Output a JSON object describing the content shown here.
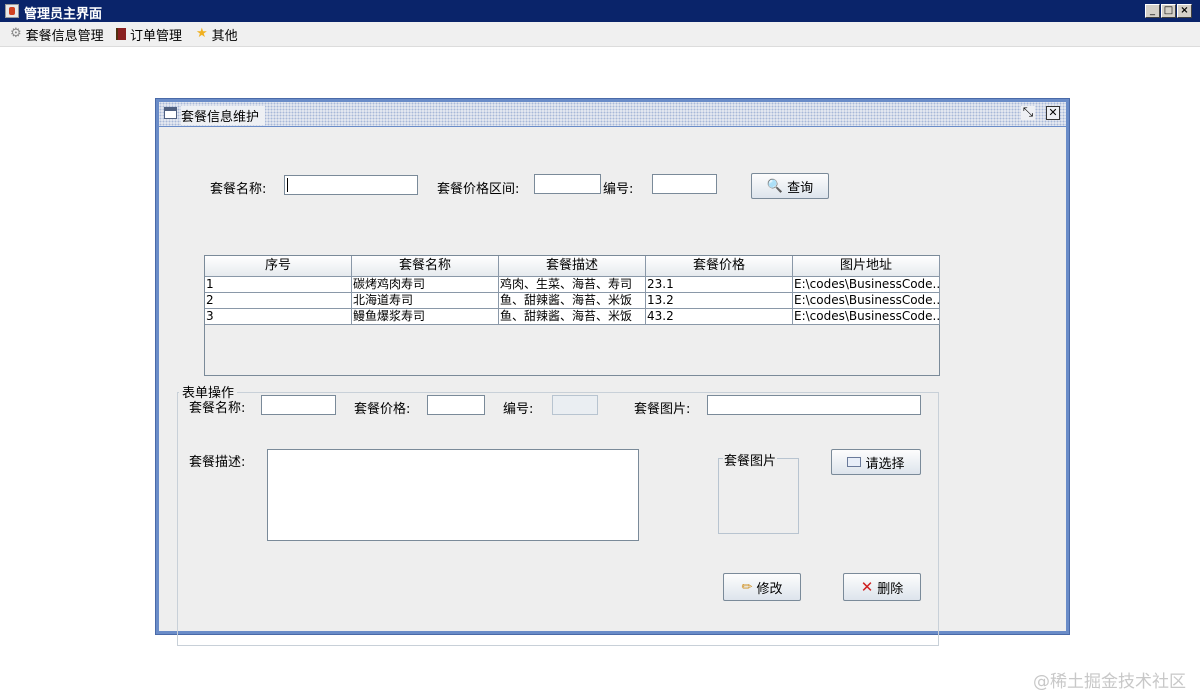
{
  "window": {
    "title": "管理员主界面"
  },
  "menu": [
    {
      "label": "套餐信息管理",
      "icon": "gear-icon"
    },
    {
      "label": "订单管理",
      "icon": "books-icon"
    },
    {
      "label": "其他",
      "icon": "star-icon"
    }
  ],
  "internal_frame": {
    "title": "套餐信息维护"
  },
  "search": {
    "name_label": "套餐名称:",
    "price_range_label": "套餐价格区间:",
    "id_label": "编号:",
    "query_button": "查询",
    "name_value": "",
    "price_min": "",
    "id_value": ""
  },
  "table": {
    "columns": [
      "序号",
      "套餐名称",
      "套餐描述",
      "套餐价格",
      "图片地址"
    ],
    "rows": [
      [
        "1",
        "碳烤鸡肉寿司",
        "鸡肉、生菜、海苔、寿司",
        "23.1",
        "E:\\codes\\BusinessCode..."
      ],
      [
        "2",
        "北海道寿司",
        "鱼、甜辣酱、海苔、米饭",
        "13.2",
        "E:\\codes\\BusinessCode..."
      ],
      [
        "3",
        "鳗鱼爆浆寿司",
        "鱼、甜辣酱、海苔、米饭",
        "43.2",
        "E:\\codes\\BusinessCode..."
      ]
    ]
  },
  "form": {
    "legend": "表单操作",
    "name_label": "套餐名称:",
    "price_label": "套餐价格:",
    "id_label": "编号:",
    "image_label": "套餐图片:",
    "desc_label": "套餐描述:",
    "image_box_title": "套餐图片",
    "choose_button": "请选择",
    "edit_button": "修改",
    "delete_button": "删除"
  },
  "watermark": "@稀土掘金技术社区"
}
